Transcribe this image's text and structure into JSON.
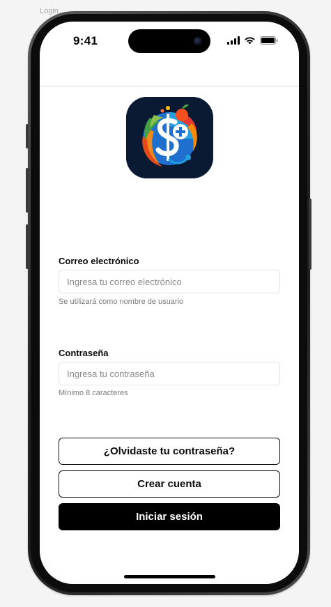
{
  "frame": {
    "label": "Login"
  },
  "status_bar": {
    "time": "9:41",
    "icons": [
      "cellular-signal-icon",
      "wifi-icon",
      "battery-icon"
    ]
  },
  "logo": {
    "icon": "health-finance-logo-icon"
  },
  "email": {
    "label": "Correo electrónico",
    "placeholder": "Ingresa tu correo electrónico",
    "value": "",
    "hint": "Se utilizará como nombre de usuario"
  },
  "password": {
    "label": "Contraseña",
    "placeholder": "Ingresa tu contraseña",
    "value": "",
    "hint": "Mínimo 8 caracteres"
  },
  "actions": {
    "forgot_password": "¿Olvidaste tu contraseña?",
    "create_account": "Crear cuenta",
    "sign_in": "Iniciar sesión"
  },
  "colors": {
    "primary_button": "#000000",
    "screen_background": "#ffffff",
    "canvas_background": "#f4f4f4"
  }
}
